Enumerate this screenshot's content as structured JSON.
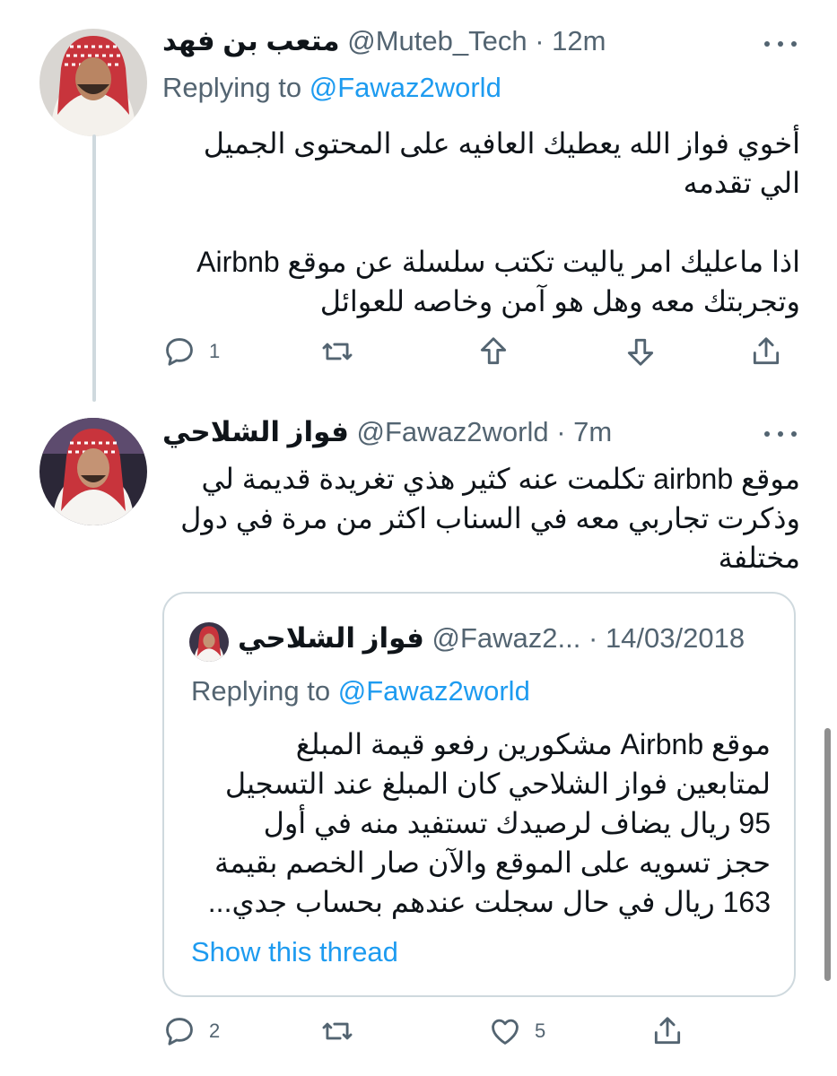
{
  "tweet1": {
    "author_name": "متعب بن فهد",
    "handle": "@Muteb_Tech",
    "separator": "·",
    "time": "12m",
    "replying_prefix": "Replying to",
    "replying_to": "@Fawaz2world",
    "text_lines": [
      "أخوي فواز الله يعطيك العافيه على المحتوى الجميل",
      "الي تقدمه",
      "",
      "اذا ماعليك امر ياليت تكتب سلسلة عن موقع Airbnb",
      "وتجربتك معه وهل هو آمن وخاصه للعوائل"
    ],
    "reply_count": "1"
  },
  "tweet2": {
    "author_name": "فواز الشلاحي",
    "handle": "@Fawaz2world",
    "separator": "·",
    "time": "7m",
    "text_lines": [
      "موقع airbnb تكلمت عنه كثير هذي تغريدة قديمة لي",
      "وذكرت تجاربي معه في السناب اكثر من مرة في دول",
      "مختلفة"
    ],
    "reply_count": "2",
    "like_count": "5"
  },
  "quote": {
    "author_name": "فواز الشلاحي",
    "handle": "@Fawaz2...",
    "separator": "·",
    "date": "14/03/2018",
    "replying_prefix": "Replying to",
    "replying_to": "@Fawaz2world",
    "text_lines": [
      "موقع Airbnb مشكورين رفعو قيمة المبلغ",
      "لمتابعين فواز الشلاحي كان المبلغ عند التسجيل",
      "95 ريال يضاف لرصيدك تستفيد منه في أول",
      "حجز تسويه على الموقع والآن صار الخصم بقيمة",
      "163 ريال في حال سجلت عندهم بحساب جدي..."
    ],
    "show_thread": "Show this thread"
  },
  "colors": {
    "text": "#0f1419",
    "secondary": "#536471",
    "link": "#1d9bf0",
    "border": "#cfd9de"
  },
  "icons": [
    "reply-icon",
    "retweet-icon",
    "upvote-icon",
    "downvote-icon",
    "share-icon",
    "like-icon",
    "more-icon"
  ]
}
